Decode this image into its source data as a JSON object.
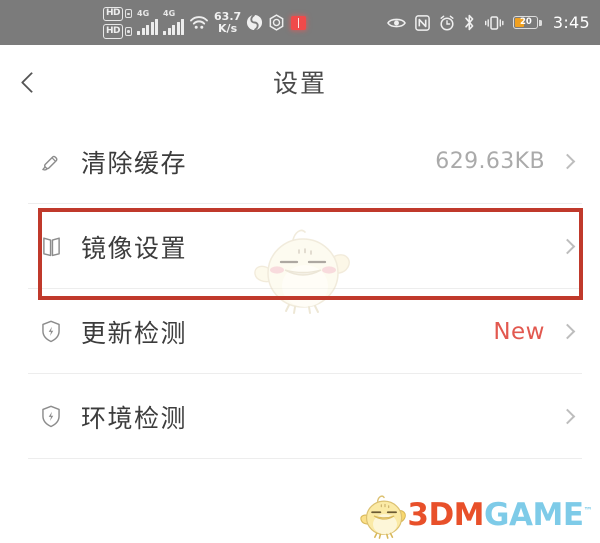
{
  "statusbar": {
    "hd_badge_1": "HD",
    "hd_badge_2": "HD",
    "network_label_1": "4G",
    "network_label_2": "4G",
    "speed_value": "63.7",
    "speed_unit": "K/s",
    "battery_level": "20",
    "time": "3:45",
    "icons_left": [
      "hd-sim-icon",
      "signal-4g-icon",
      "signal-4g-icon",
      "wifi-icon",
      "network-speed",
      "globe-app-icon",
      "shield-app-icon",
      "red-app-icon"
    ],
    "icons_right": [
      "eye-icon",
      "nfc-icon",
      "alarm-clock-icon",
      "bluetooth-icon",
      "vibrate-icon",
      "battery-icon"
    ]
  },
  "header": {
    "title": "设置",
    "back_icon": "chevron-left-icon"
  },
  "list": {
    "rows": [
      {
        "label": "清除缓存",
        "value": "629.63KB",
        "icon": "brush-icon",
        "highlighted": false,
        "value_style": "normal"
      },
      {
        "label": "镜像设置",
        "value": "",
        "icon": "mirror-icon",
        "highlighted": true,
        "value_style": "normal"
      },
      {
        "label": "更新检测",
        "value": "New",
        "icon": "shield-bolt-icon",
        "highlighted": false,
        "value_style": "new"
      },
      {
        "label": "环境检测",
        "value": "",
        "icon": "shield-bolt-icon",
        "highlighted": false,
        "value_style": "normal"
      }
    ]
  },
  "watermark": {
    "chick": "chick-mascot-watermark"
  },
  "footer": {
    "logo_part1": "3DM",
    "logo_part2": "GAME",
    "logo_tm": "™",
    "logo_chick": "chick-mascot-logo"
  },
  "colors": {
    "highlight_border": "#c0392b",
    "badge_new": "#e2584f",
    "statusbar_bg": "#7b7b7b",
    "battery_fill": "#f0a020",
    "logo_orange": "#e8502a",
    "logo_blue": "#7ecbe8"
  }
}
